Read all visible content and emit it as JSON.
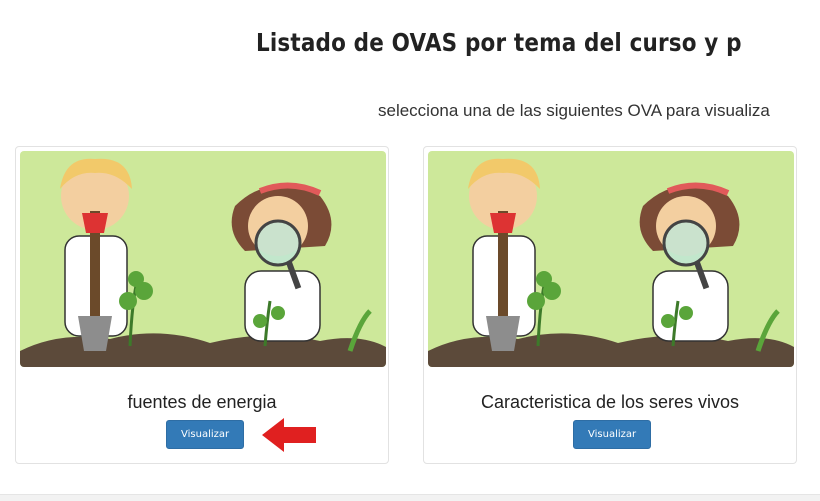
{
  "page": {
    "title": "Listado de OVAS por tema del curso y periodo s",
    "subtitle": "selecciona una de las siguientes OVA para visualiza"
  },
  "cards": [
    {
      "title": "fuentes de energia",
      "button_label": "Visualizar",
      "image": "kids-science-garden-illustration"
    },
    {
      "title": "Caracteristica de los seres vivos",
      "button_label": "Visualizar",
      "image": "kids-science-garden-illustration"
    }
  ],
  "annotation": {
    "icon": "red-arrow-left-icon",
    "color": "#e02020"
  },
  "colors": {
    "button": "#337ab7",
    "thumb_bg": "#cde89a"
  }
}
